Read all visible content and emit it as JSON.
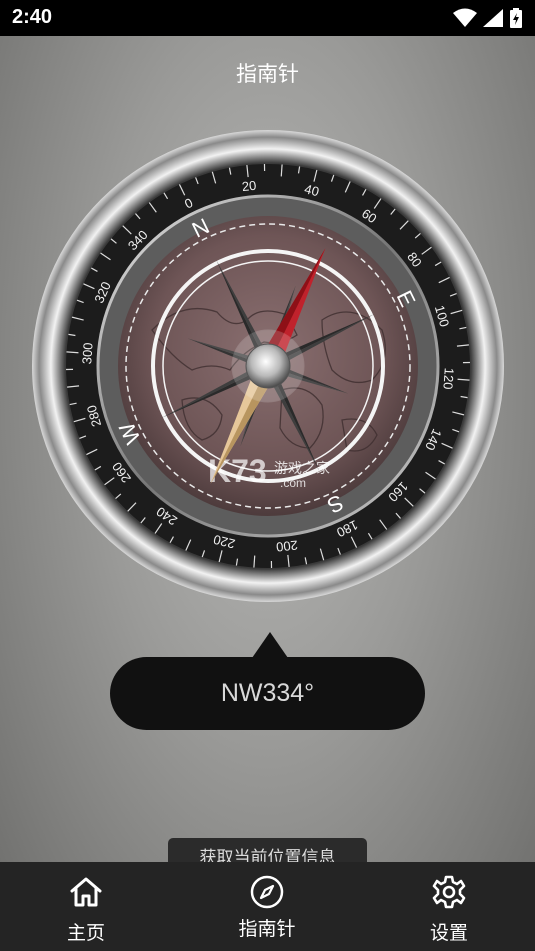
{
  "status_bar": {
    "time": "2:40"
  },
  "header": {
    "title": "指南针"
  },
  "compass": {
    "degree_labels": [
      "0",
      "20",
      "40",
      "60",
      "80",
      "100",
      "120",
      "140",
      "160",
      "180",
      "200",
      "220",
      "240",
      "260",
      "280",
      "300",
      "320",
      "340"
    ],
    "cardinals": [
      "N",
      "E",
      "S",
      "W"
    ],
    "watermark_main": "K73",
    "watermark_sub": "游戏之家",
    "watermark_domain": ".com"
  },
  "heading": {
    "direction": "NW",
    "degrees": 334,
    "display": "NW334°"
  },
  "location_button": {
    "label": "获取当前位置信息"
  },
  "bottom_nav": {
    "items": [
      {
        "label": "主页",
        "icon": "home-icon"
      },
      {
        "label": "指南针",
        "icon": "compass-icon"
      },
      {
        "label": "设置",
        "icon": "gear-icon"
      }
    ]
  },
  "colors": {
    "needle_north": "#c0222c",
    "needle_south": "#e6c79a",
    "nav_bg": "#242424"
  }
}
